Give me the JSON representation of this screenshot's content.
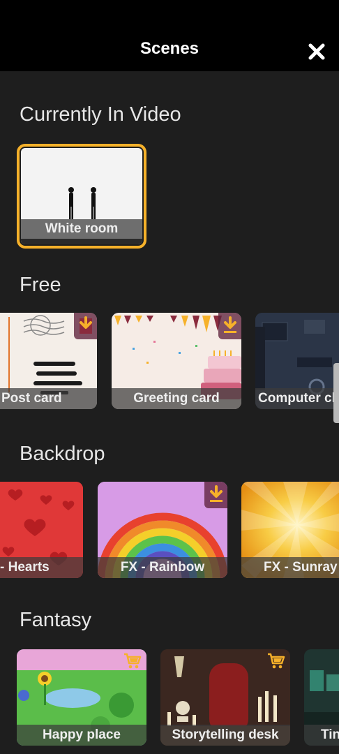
{
  "header": {
    "title": "Scenes",
    "close_icon": "close-icon"
  },
  "current": {
    "heading": "Currently In Video",
    "item": {
      "label": "White room",
      "selected_color": "#f6b12a"
    }
  },
  "free": {
    "heading": "Free",
    "items": [
      {
        "label": "Post card",
        "icon": "download-icon"
      },
      {
        "label": "Greeting card",
        "icon": "download-icon"
      },
      {
        "label": "Computer cl"
      }
    ]
  },
  "backdrop": {
    "heading": "Backdrop",
    "items": [
      {
        "label": "- Hearts"
      },
      {
        "label": "FX - Rainbow",
        "icon": "download-icon"
      },
      {
        "label": "FX - Sunray"
      }
    ]
  },
  "fantasy": {
    "heading": "Fantasy",
    "items": [
      {
        "label": "Happy place",
        "icon": "cart-icon"
      },
      {
        "label": "Storytelling desk",
        "icon": "cart-icon"
      },
      {
        "label": "Tin"
      }
    ]
  },
  "colors": {
    "background": "#1e1e1e",
    "header": "#000000",
    "accent": "#f6b12a"
  }
}
